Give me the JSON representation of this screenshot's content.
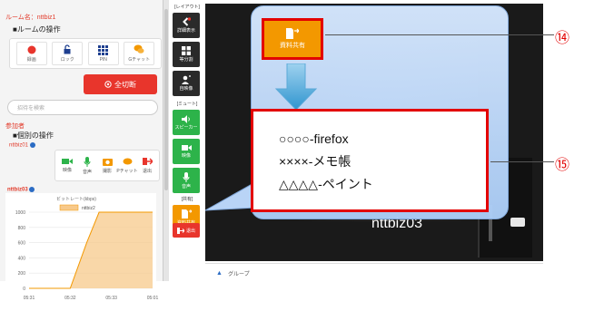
{
  "left_panel": {
    "room_name": "ルーム名：nttbiz1",
    "room_ops_title": "■ルームの操作",
    "room_ops": [
      {
        "label": "録画",
        "icon": "record-icon",
        "color": "#e8352c"
      },
      {
        "label": "ロック",
        "icon": "lock-icon",
        "color": "#1e3f8f"
      },
      {
        "label": "PIN",
        "icon": "pin-grid-icon",
        "color": "#1e3f8f"
      },
      {
        "label": "Gチャット",
        "icon": "group-chat-icon",
        "color": "#f39800"
      }
    ],
    "disconnect_all": "全切断",
    "invite_placeholder": "招待を検索",
    "participants_label": "参加者",
    "individual_ops_title": "■個別の操作",
    "user1": "nttbiz01",
    "individual_ops": [
      {
        "label": "映像",
        "icon": "video-icon",
        "color": "#2db34a"
      },
      {
        "label": "音声",
        "icon": "mic-icon",
        "color": "#2db34a"
      },
      {
        "label": "撮影",
        "icon": "camera-icon",
        "color": "#f39800"
      },
      {
        "label": "Pチャット",
        "icon": "private-chat-icon",
        "color": "#f39800"
      },
      {
        "label": "退出",
        "icon": "exit-icon",
        "color": "#e8352c"
      }
    ],
    "user2": "nttbiz03",
    "bitrate_chart": {
      "title": "ビットレート(kbps)",
      "legend": "nttbiz2",
      "y_ticks": [
        "1000",
        "800",
        "600",
        "400",
        "200",
        "0"
      ],
      "x_ticks": [
        "05:31",
        "05:32",
        "05:33",
        "05:01"
      ]
    }
  },
  "chart_data": {
    "type": "area",
    "title": "ビットレート(kbps)",
    "xlabel": "",
    "ylabel": "",
    "x": [
      "05:31",
      "05:32",
      "05:33",
      "05:01"
    ],
    "ylim": [
      0,
      1000
    ],
    "series": [
      {
        "name": "nttbiz2",
        "points": [
          [
            0.0,
            0
          ],
          [
            1.0,
            0
          ],
          [
            1.4,
            600
          ],
          [
            1.7,
            1000
          ],
          [
            3.0,
            1000
          ]
        ]
      }
    ],
    "legend": "top-center",
    "grid": true,
    "color": "#f39800"
  },
  "toolbar": {
    "layout_header": "[レイアウト]",
    "detail_view": "詳細表示",
    "split_view": "等分割",
    "self_view": "自映像",
    "mute_header": "[ミュート]",
    "speaker": "スピーカー",
    "video": "映像",
    "voice": "音声",
    "share_header": "[共有]",
    "material_share": "資料共有",
    "leave": "退出"
  },
  "video": {
    "participant_name": "nttbiz03"
  },
  "group_bar": {
    "label": "グループ"
  },
  "callout": {
    "share_button_label": "資料共有",
    "marker_14": "⑭",
    "marker_15": "⑮",
    "windows": [
      "○○○○-firefox",
      "××××-メモ帳",
      "△△△△-ペイント"
    ]
  },
  "colors": {
    "accent_red": "#e30000",
    "orange": "#f39800",
    "green": "#2db34a",
    "dark": "#2a2a2a",
    "bubble": "#c3dbfa"
  }
}
